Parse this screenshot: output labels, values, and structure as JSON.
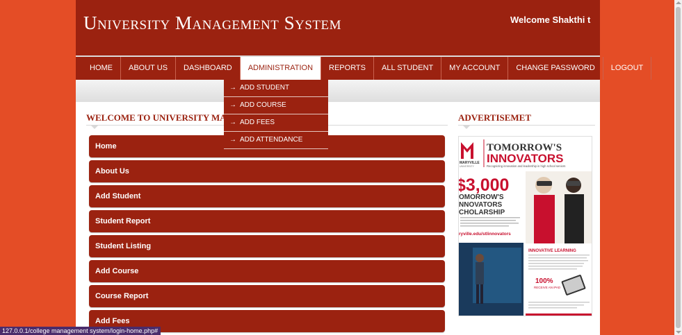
{
  "header": {
    "title": "University Management System",
    "welcome": "Welcome Shakthi t"
  },
  "nav": {
    "items": [
      "HOME",
      "ABOUT US",
      "DASHBOARD",
      "ADMINISTRATION",
      "REPORTS",
      "ALL STUDENT",
      "MY ACCOUNT",
      "CHANGE PASSWORD",
      "LOGOUT"
    ],
    "active": "ADMINISTRATION"
  },
  "dropdown": {
    "items": [
      "ADD STUDENT",
      "ADD COURSE",
      "ADD FEES",
      "ADD ATTENDANCE"
    ]
  },
  "main": {
    "section_title": "WELCOME TO UNIVERSITY MANAGEMENT SYSTEM",
    "menu": [
      "Home",
      "About Us",
      "Add Student",
      "Student Report",
      "Student Listing",
      "Add Course",
      "Course Report",
      "Add Fees"
    ]
  },
  "sidebar": {
    "title": "ADVERTISEMET",
    "ad": {
      "brand": "MARYVILLE",
      "brand_sub": "UNIVERSITY",
      "headline_1": "TOMORROW'S",
      "headline_2": "INNOVATORS",
      "tagline": "Recognizing innovation and leadership in high school seniors",
      "amount": "$3,000",
      "sch_1": "OMORROW'S",
      "sch_2": "NNOVATORS",
      "sch_3": "CHOLARSHIP",
      "url": "ryville.edu/stlinnovators",
      "section": "INNOVATIVE LEARNING",
      "promo_big": "100%",
      "promo_small": "RECEIVE AN iPAD"
    }
  },
  "statusbar": {
    "url": "127.0.0.1/college management system/login-home.php#"
  },
  "colors": {
    "brand": "#9b2210",
    "background": "#e44d26",
    "status_bar": "#4a2c6b"
  }
}
